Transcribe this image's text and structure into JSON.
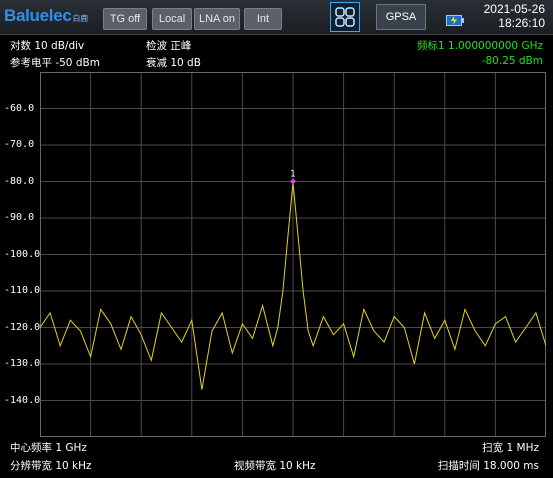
{
  "topbar": {
    "brand_logo": "Baluelec",
    "brand_sub": "白鹿",
    "buttons": [
      "TG off",
      "Local",
      "LNA on",
      "Int"
    ],
    "mode": "GPSA",
    "date": "2021-05-26",
    "time": "18:26:10",
    "icons": [
      "app-grid-icon",
      "battery-charging-icon"
    ]
  },
  "header": {
    "scale": "对数 10 dB/div",
    "ref_level": "参考电平 -50 dBm",
    "detector": "检波 正峰",
    "attenuation": "衰减 10 dB",
    "marker_freq": "频标1  1.000000000 GHz",
    "marker_amp": "-80.25 dBm"
  },
  "chart_data": {
    "type": "line",
    "y_ticks": [
      "-60.0",
      "-70.0",
      "-80.0",
      "-90.0",
      "-100.0",
      "-110.0",
      "-120.0",
      "-130.0",
      "-140.0"
    ],
    "ylim": [
      -150,
      -50
    ],
    "grid": true,
    "trace_color": "#e6d21e",
    "marker": {
      "label": "1",
      "x_freq_ghz": 1.0,
      "y_dbm": -80.25
    },
    "series": [
      {
        "x_mhz": [
          999.5,
          999.52,
          999.54,
          999.56,
          999.58,
          999.6,
          999.62,
          999.64,
          999.66,
          999.68,
          999.7,
          999.72,
          999.74,
          999.76,
          999.78,
          999.8,
          999.82,
          999.84,
          999.86,
          999.88,
          999.9,
          999.92,
          999.94,
          999.96,
          999.97,
          999.98,
          999.99,
          1000.0,
          1000.01,
          1000.02,
          1000.03,
          1000.04,
          1000.06,
          1000.08,
          1000.1,
          1000.12,
          1000.14,
          1000.16,
          1000.18,
          1000.2,
          1000.22,
          1000.24,
          1000.26,
          1000.28,
          1000.3,
          1000.32,
          1000.34,
          1000.36,
          1000.38,
          1000.4,
          1000.42,
          1000.44,
          1000.46,
          1000.48,
          1000.5
        ],
        "y_dbm": [
          -120,
          -116,
          -125,
          -118,
          -121,
          -128,
          -115,
          -119,
          -126,
          -117,
          -122,
          -129,
          -116,
          -120,
          -124,
          -118,
          -137,
          -121,
          -116,
          -127,
          -119,
          -123,
          -114,
          -125,
          -120,
          -110,
          -95,
          -80.25,
          -95,
          -110,
          -121,
          -125,
          -117,
          -122,
          -119,
          -128,
          -115,
          -121,
          -124,
          -117,
          -120,
          -130,
          -116,
          -123,
          -118,
          -126,
          -115,
          -121,
          -125,
          -119,
          -117,
          -124,
          -120,
          -116,
          -125
        ]
      }
    ]
  },
  "footer": {
    "center_freq": "中心频率 1 GHz",
    "span": "扫宽 1 MHz",
    "rbw": "分辨带宽 10 kHz",
    "vbw": "视频带宽 10 kHz",
    "sweep_time": "扫描时间 18.000 ms"
  }
}
